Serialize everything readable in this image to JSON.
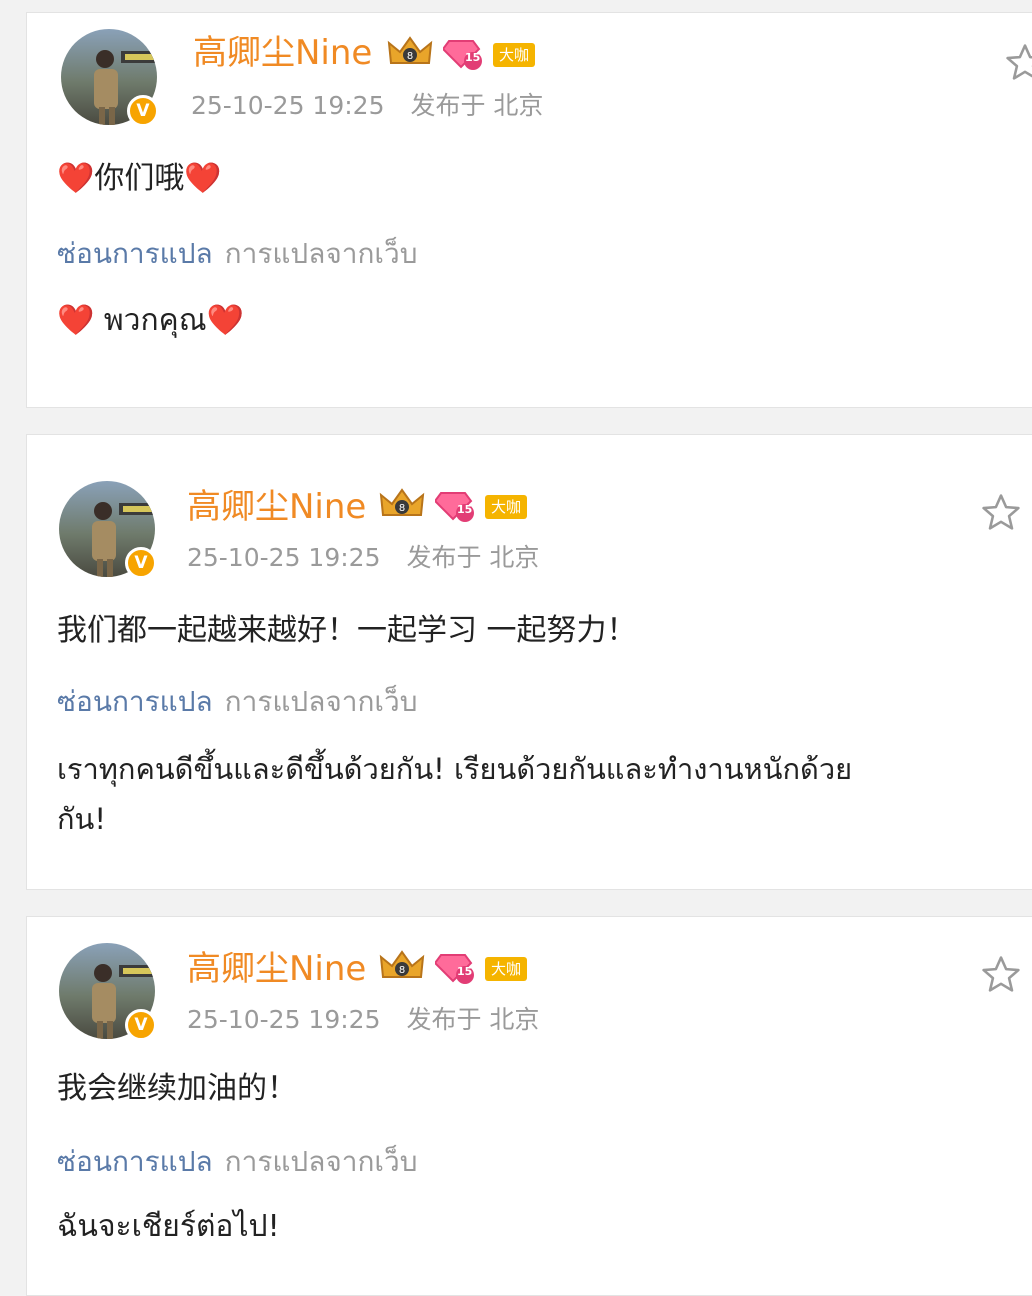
{
  "posts": [
    {
      "username": "高卿尘Nine",
      "level": "15",
      "tag": "大咖",
      "verified_mark": "V",
      "timestamp": "25-10-25 19:25",
      "published_at": "发布于 北京",
      "text_pre": "❤️",
      "text_main": "你们哦",
      "text_post": "❤️",
      "hide_translation": "ซ่อนการแปล",
      "translation_source": "การแปลจากเว็บ",
      "translation_pre": "❤️ ",
      "translation_main": "พวกคุณ",
      "translation_post": "❤️"
    },
    {
      "username": "高卿尘Nine",
      "level": "15",
      "tag": "大咖",
      "verified_mark": "V",
      "timestamp": "25-10-25 19:25",
      "published_at": "发布于 北京",
      "text_main": "我们都一起越来越好！一起学习 一起努力！",
      "hide_translation": "ซ่อนการแปล",
      "translation_source": "การแปลจากเว็บ",
      "translation_line1": "เราทุกคนดีขึ้นและดีขึ้นด้วยกัน! เรียนด้วยกันและทำงานหนักด้วย",
      "translation_line2": "กัน!"
    },
    {
      "username": "高卿尘Nine",
      "level": "15",
      "tag": "大咖",
      "verified_mark": "V",
      "timestamp": "25-10-25 19:25",
      "published_at": "发布于 北京",
      "text_main": "我会继续加油的！",
      "hide_translation": "ซ่อนการแปล",
      "translation_source": "การแปลจากเว็บ",
      "translation_main": "ฉันจะเชียร์ต่อไป!"
    }
  ],
  "icons": {
    "crown": "crown-icon",
    "diamond": "diamond-level-icon",
    "star": "star-outline-icon",
    "verified": "verified-badge-icon"
  },
  "colors": {
    "username": "#f08a24",
    "link": "#5a7aa8",
    "meta": "#9a9a9a",
    "verified": "#f7a400",
    "tag": "#f5b400"
  }
}
